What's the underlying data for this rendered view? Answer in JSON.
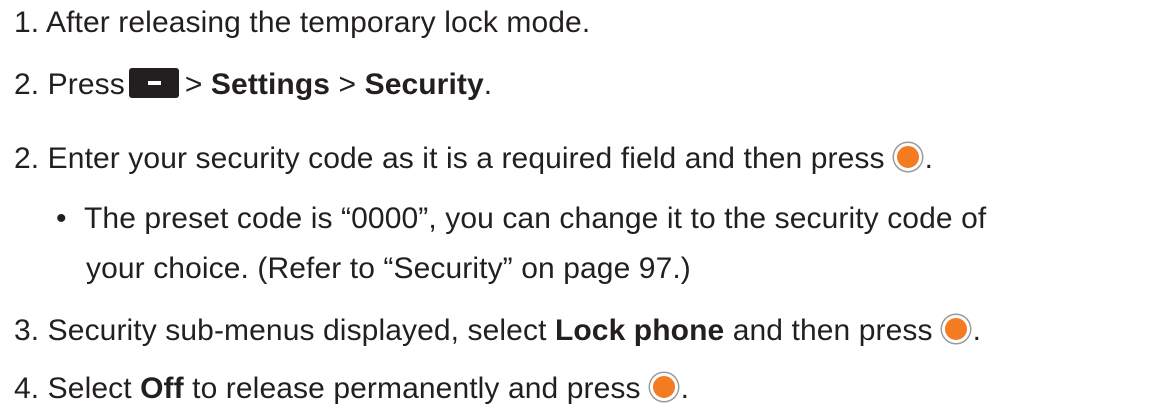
{
  "steps": [
    {
      "num": "1.",
      "text": "After releasing the temporary lock mode."
    },
    {
      "num": "2.",
      "pre": "Press",
      "sep1": ">",
      "bold1": "Settings",
      "sep2": ">",
      "bold2": "Security",
      "end": "."
    },
    {
      "num": "2.",
      "text": "Enter your security code as it is a required field and then press",
      "end": "."
    },
    {
      "bullet": "•",
      "text": "The preset code is “0000”, you can change it to the security code of",
      "cont": "your choice. (Refer to “Security” on page 97.)"
    },
    {
      "num": "3.",
      "pre": "Security sub-menus displayed, select",
      "bold": "Lock phone",
      "post": "and then press",
      "end": "."
    },
    {
      "num": "4.",
      "pre": "Select",
      "bold": "Off",
      "post": "to release permanently and press",
      "end": "."
    }
  ],
  "icons": {
    "softkey": "left-soft-key-icon",
    "ok": "ok-button-icon",
    "ok_color": "#f47b20",
    "text_color": "#231f20"
  }
}
